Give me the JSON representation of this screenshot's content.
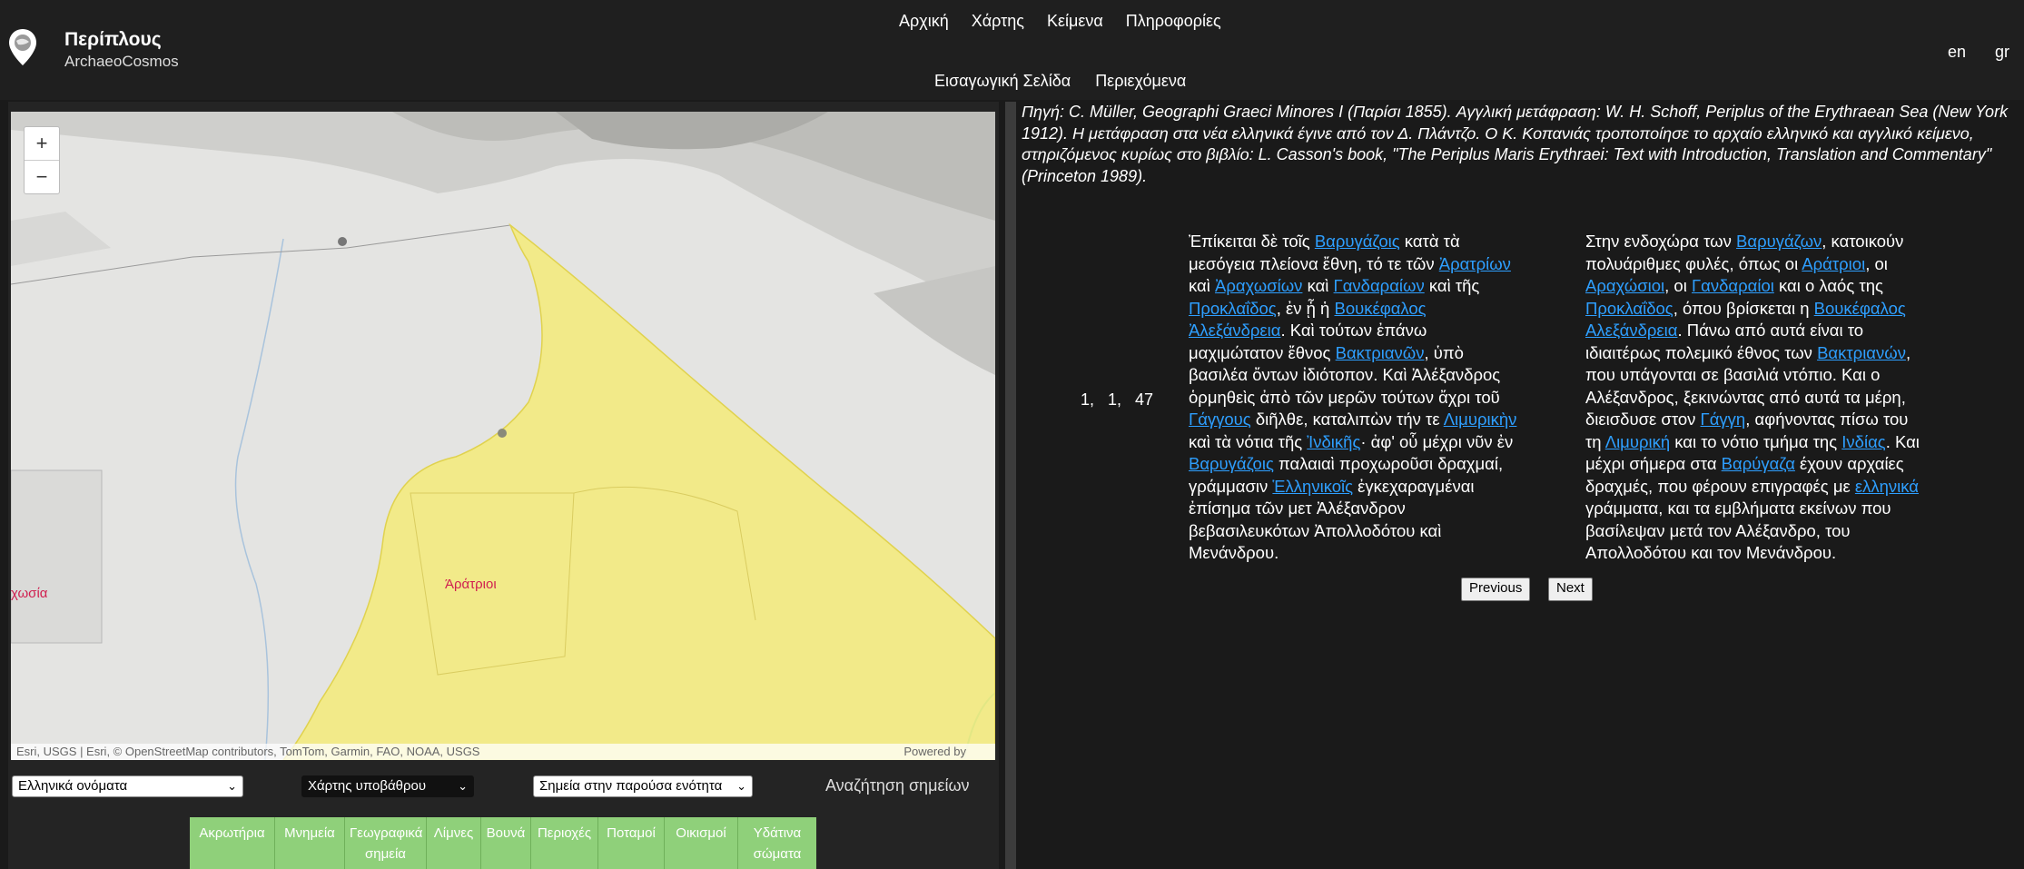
{
  "header": {
    "brand_title": "Περίπλους",
    "brand_subtitle": "ArchaeoCosmos",
    "nav": [
      "Αρχική",
      "Χάρτης",
      "Κείμενα",
      "Πληροφορίες"
    ],
    "subnav": [
      "Εισαγωγική Σελίδα",
      "Περιεχόμενα"
    ],
    "lang_en": "en",
    "lang_gr": "gr"
  },
  "map": {
    "zoom_in": "+",
    "zoom_out": "−",
    "label_aratrioi": "Άράτριοι",
    "label_left": "χωσία",
    "attribution": "Esri, USGS | Esri, © OpenStreetMap contributors, TomTom, Garmin, FAO, NOAA, USGS",
    "powered_by": "Powered by"
  },
  "controls": {
    "names_select": "Ελληνικά ονόματα",
    "basemap_select": "Χάρτης υποβάθρου",
    "points_select": "Σημεία στην παρούσα ενότητα",
    "search_label": "Αναζήτηση σημείων"
  },
  "filters": [
    {
      "l1": "Ακρωτήρια",
      "l2": ""
    },
    {
      "l1": "Μνημεία",
      "l2": ""
    },
    {
      "l1": "Γεωγραφικά",
      "l2": "σημεία"
    },
    {
      "l1": "Λίμνες",
      "l2": ""
    },
    {
      "l1": "Βουνά",
      "l2": ""
    },
    {
      "l1": "Περιοχές",
      "l2": ""
    },
    {
      "l1": "Ποταμοί",
      "l2": ""
    },
    {
      "l1": "Οικισμοί",
      "l2": ""
    },
    {
      "l1": "Υδάτινα",
      "l2": "σώματα"
    }
  ],
  "text": {
    "source_note": "Πηγή: C. Müller, Geographi Graeci Minores I (Παρίσι 1855). Αγγλική μετάφραση: W. H. Schoff, Periplus of the Erythraean Sea (New York 1912). Η μετάφραση στα νέα ελληνικά έγινε από τον Δ. Πλάντζο. Ο Κ. Κοπανιάς τροποποίησε το αρχαίο ελληνικό και αγγλικό κείμενο, στηριζόμενος κυρίως στο βιβλίο: L. Casson's book, \"The Periplus Maris Erythraei: Text with Introduction, Translation and Commentary\" (Princeton 1989).",
    "ref": "1,   1,   47",
    "greek_ancient": [
      [
        {
          "t": "Ἐπίκειται δὲ τοῖς "
        },
        {
          "t": "Βαρυγάζοις",
          "l": 1
        },
        {
          "t": " κατὰ τὰ"
        }
      ],
      [
        {
          "t": "μεσόγεια πλείονα ἔθνη, τό τε τῶν "
        },
        {
          "t": "Ἀρατρίων",
          "l": 1
        }
      ],
      [
        {
          "t": "καὶ "
        },
        {
          "t": "Ἀραχωσίων",
          "l": 1
        },
        {
          "t": " καὶ "
        },
        {
          "t": "Γανδαραίων",
          "l": 1
        },
        {
          "t": " καὶ τῆς"
        }
      ],
      [
        {
          "t": "Προκλαΐδος",
          "l": 1
        },
        {
          "t": ", ἐν ᾗ ἡ "
        },
        {
          "t": "Βουκέφαλος",
          "l": 1
        }
      ],
      [
        {
          "t": "Ἀλεξάνδρεια",
          "l": 1
        },
        {
          "t": ". Καὶ τούτων ἐπάνω"
        }
      ],
      [
        {
          "t": "μαχιμώτατον ἔθνος "
        },
        {
          "t": "Βακτριανῶν",
          "l": 1
        },
        {
          "t": ", ὑπὸ"
        }
      ],
      [
        {
          "t": "βασιλέα ὄντων ἰδιότοπον. Καὶ Ἀλέξανδρος"
        }
      ],
      [
        {
          "t": "ὁρμηθεὶς ἀπὸ τῶν μερῶν τούτων ἄχρι τοῦ"
        }
      ],
      [
        {
          "t": "Γάγγους",
          "l": 1
        },
        {
          "t": " διῆλθε, καταλιπὼν τήν τε "
        },
        {
          "t": "Λιμυρικὴν",
          "l": 1
        }
      ],
      [
        {
          "t": "καὶ τὰ νότια τῆς "
        },
        {
          "t": "Ἰνδικῆς",
          "l": 1
        },
        {
          "t": "· ἀφ' οὗ μέχρι νῦν ἐν"
        }
      ],
      [
        {
          "t": "Βαρυγάζοις",
          "l": 1
        },
        {
          "t": " παλαιαὶ προχωροῦσι δραχμαί,"
        }
      ],
      [
        {
          "t": "γράμμασιν "
        },
        {
          "t": "Ἑλληνικοῖς",
          "l": 1
        },
        {
          "t": " ἐγκεχαραγμέναι"
        }
      ],
      [
        {
          "t": "ἐπίσημα τῶν μετ Ἀλέξανδρον"
        }
      ],
      [
        {
          "t": "βεβασιλευκότων Ἀπολλοδότου καὶ"
        }
      ],
      [
        {
          "t": "Μενάνδρου."
        }
      ]
    ],
    "greek_modern": [
      [
        {
          "t": "Στην ενδοχώρα των "
        },
        {
          "t": "Βαρυγάζων",
          "l": 1
        },
        {
          "t": ", κατοικούν"
        }
      ],
      [
        {
          "t": "πολυάριθμες φυλές, όπως οι "
        },
        {
          "t": "Αράτριοι",
          "l": 1
        },
        {
          "t": ", οι"
        }
      ],
      [
        {
          "t": "Αραχώσιοι",
          "l": 1
        },
        {
          "t": ", οι "
        },
        {
          "t": "Γανδαραίοι",
          "l": 1
        },
        {
          "t": " και ο λαός της"
        }
      ],
      [
        {
          "t": "Προκλαΐδος",
          "l": 1
        },
        {
          "t": ", όπου βρίσκεται η "
        },
        {
          "t": "Βουκέφαλος",
          "l": 1
        }
      ],
      [
        {
          "t": "Αλεξάνδρεια",
          "l": 1
        },
        {
          "t": ". Πάνω από αυτά είναι το"
        }
      ],
      [
        {
          "t": "ιδιαιτέρως πολεμικό έθνος των "
        },
        {
          "t": "Βακτριανών",
          "l": 1
        },
        {
          "t": ","
        }
      ],
      [
        {
          "t": "που υπάγονται σε βασιλιά ντόπιο. Και ο"
        }
      ],
      [
        {
          "t": "Αλέξανδρος, ξεκινώντας από αυτά τα μέρη,"
        }
      ],
      [
        {
          "t": "διεισδυσε στον "
        },
        {
          "t": "Γάγγη",
          "l": 1
        },
        {
          "t": ", αφήνοντας πίσω του"
        }
      ],
      [
        {
          "t": "τη "
        },
        {
          "t": "Λιμυρική",
          "l": 1
        },
        {
          "t": " και το νότιο τμήμα της "
        },
        {
          "t": "Ινδίας",
          "l": 1
        },
        {
          "t": ". Και"
        }
      ],
      [
        {
          "t": "μέχρι σήμερα στα "
        },
        {
          "t": "Βαρύγαζα",
          "l": 1
        },
        {
          "t": " έχουν αρχαίες"
        }
      ],
      [
        {
          "t": "δραχμές, που φέρουν επιγραφές με "
        },
        {
          "t": "ελληνικά",
          "l": 1
        }
      ],
      [
        {
          "t": "γράμματα, και τα εμβλήματα εκείνων που"
        }
      ],
      [
        {
          "t": "βασίλεψαν μετά τον Αλέξανδρο, του"
        }
      ],
      [
        {
          "t": "Απολλοδότου και τον Μενάνδρου."
        }
      ]
    ],
    "prev_label": "Previous",
    "next_label": "Next"
  }
}
